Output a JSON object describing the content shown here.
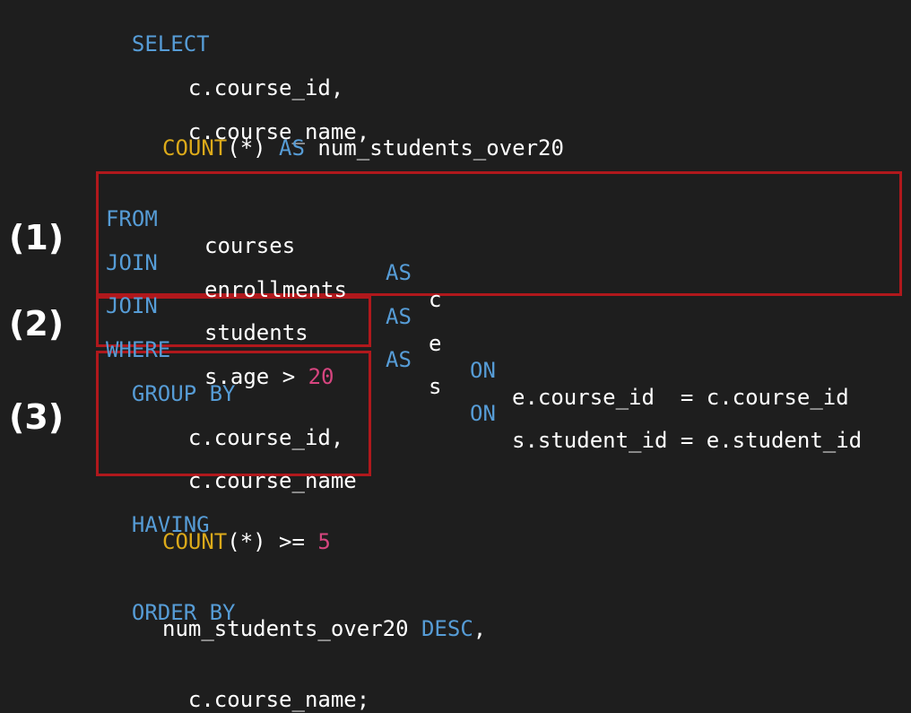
{
  "labels": [
    "(1)",
    "(2)",
    "(3)"
  ],
  "sql": {
    "select_kw": "SELECT",
    "select_col1": "c.course_id,",
    "select_col2": "c.course_name,",
    "count_fn": "COUNT",
    "count_args": "(*) ",
    "as_kw": "AS",
    "count_alias": " num_students_over20",
    "from_kw": "FROM",
    "from_table": "courses",
    "from_alias": "c",
    "join_kw": "JOIN",
    "join1_table": "enrollments",
    "join1_alias": "e",
    "on_kw": "ON",
    "join1_cond": "e.course_id  = c.course_id",
    "join2_table": "students",
    "join2_alias": "s",
    "join2_cond": "s.student_id = e.student_id",
    "where_kw": "WHERE",
    "where_cond": "s.age > ",
    "where_value": "20",
    "group_kw": "GROUP BY",
    "group_col1": "c.course_id,",
    "group_col2": "c.course_name",
    "having_kw": "HAVING",
    "having_fn": "COUNT",
    "having_cond": "(*) >= ",
    "having_value": "5",
    "order_kw": "ORDER BY",
    "order_col1": "num_students_over20 ",
    "desc_kw": "DESC",
    "order_comma": ",",
    "order_col2": "c.course_name;"
  },
  "colors": {
    "background": "#1e1e1e",
    "keyword": "#569cd6",
    "function": "#dcaa1a",
    "number": "#d6457f",
    "text": "#ffffff",
    "highlight_box": "#b0181c"
  }
}
